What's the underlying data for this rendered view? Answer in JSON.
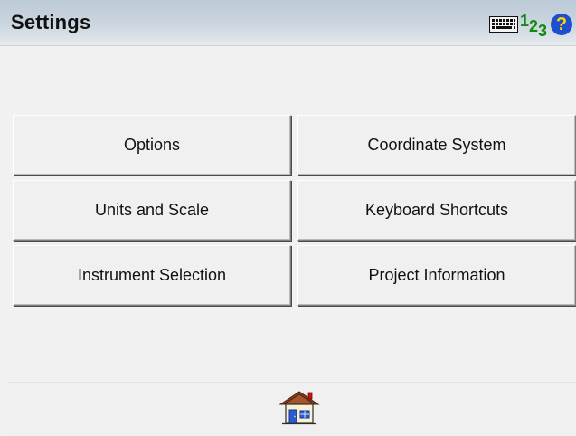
{
  "window": {
    "title": "Settings"
  },
  "status_icons": {
    "keyboard_icon": "keyboard-icon",
    "numeric_mode": [
      "1",
      "2",
      "3"
    ],
    "help_icon": "?"
  },
  "buttons": [
    {
      "label": "Options"
    },
    {
      "label": "Coordinate System"
    },
    {
      "label": "Units and Scale"
    },
    {
      "label": "Keyboard Shortcuts"
    },
    {
      "label": "Instrument Selection"
    },
    {
      "label": "Project Information"
    }
  ],
  "footer": {
    "home_icon": "home-icon"
  },
  "colors": {
    "titlebar_top": "#bccbd8",
    "accent_green": "#128a12",
    "help_blue": "#1d4fcf",
    "help_yellow": "#ffd200"
  }
}
